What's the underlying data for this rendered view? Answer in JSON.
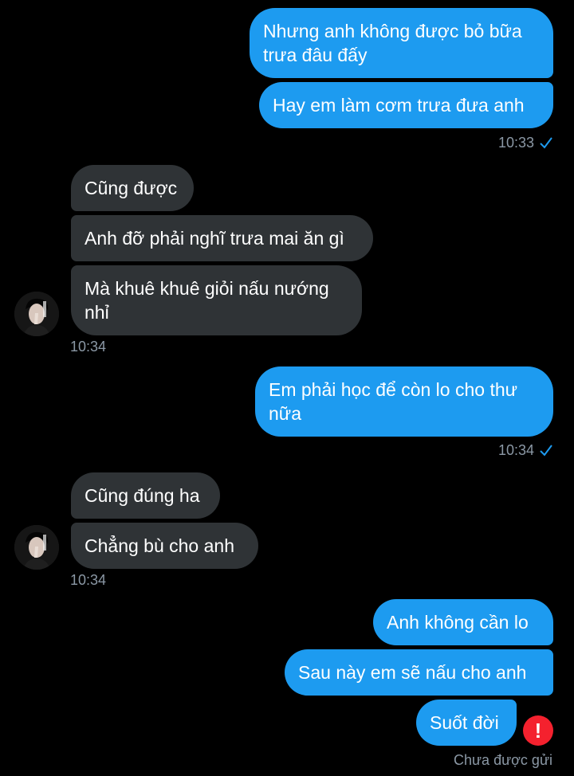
{
  "colors": {
    "outgoing_bubble": "#1d9bf0",
    "incoming_bubble": "#2f3336",
    "timestamp_text": "#8b98a5",
    "read_check": "#1d9bf0",
    "error": "#f4212e"
  },
  "messages": [
    {
      "direction": "out",
      "text": "Nhưng anh không được bỏ bữa\ntrưa đâu đấy"
    },
    {
      "direction": "out",
      "text": "Hay em làm cơm trưa đưa anh"
    },
    {
      "direction": "in",
      "text": "Cũng được"
    },
    {
      "direction": "in",
      "text": "Anh đỡ phải nghĩ trưa mai ăn gì"
    },
    {
      "direction": "in",
      "text": "Mà khuê khuê giỏi nấu nướng\nnhỉ"
    },
    {
      "direction": "out",
      "text": "Em phải học để còn lo cho thư\nnữa"
    },
    {
      "direction": "in",
      "text": "Cũng đúng ha"
    },
    {
      "direction": "in",
      "text": "Chẳng bù cho anh"
    },
    {
      "direction": "out",
      "text": "Anh không cần lo"
    },
    {
      "direction": "out",
      "text": "Sau này em sẽ nấu cho anh"
    },
    {
      "direction": "out",
      "text": "Suốt đời"
    }
  ],
  "timestamps": {
    "t1": "10:33",
    "t2": "10:34",
    "t3": "10:34",
    "t4": "10:34"
  },
  "status": {
    "read_icon": "check-icon",
    "error_icon": "exclamation-icon",
    "error_symbol": "!",
    "not_sent": "Chưa được gửi"
  },
  "avatar_icon": "contact-avatar"
}
